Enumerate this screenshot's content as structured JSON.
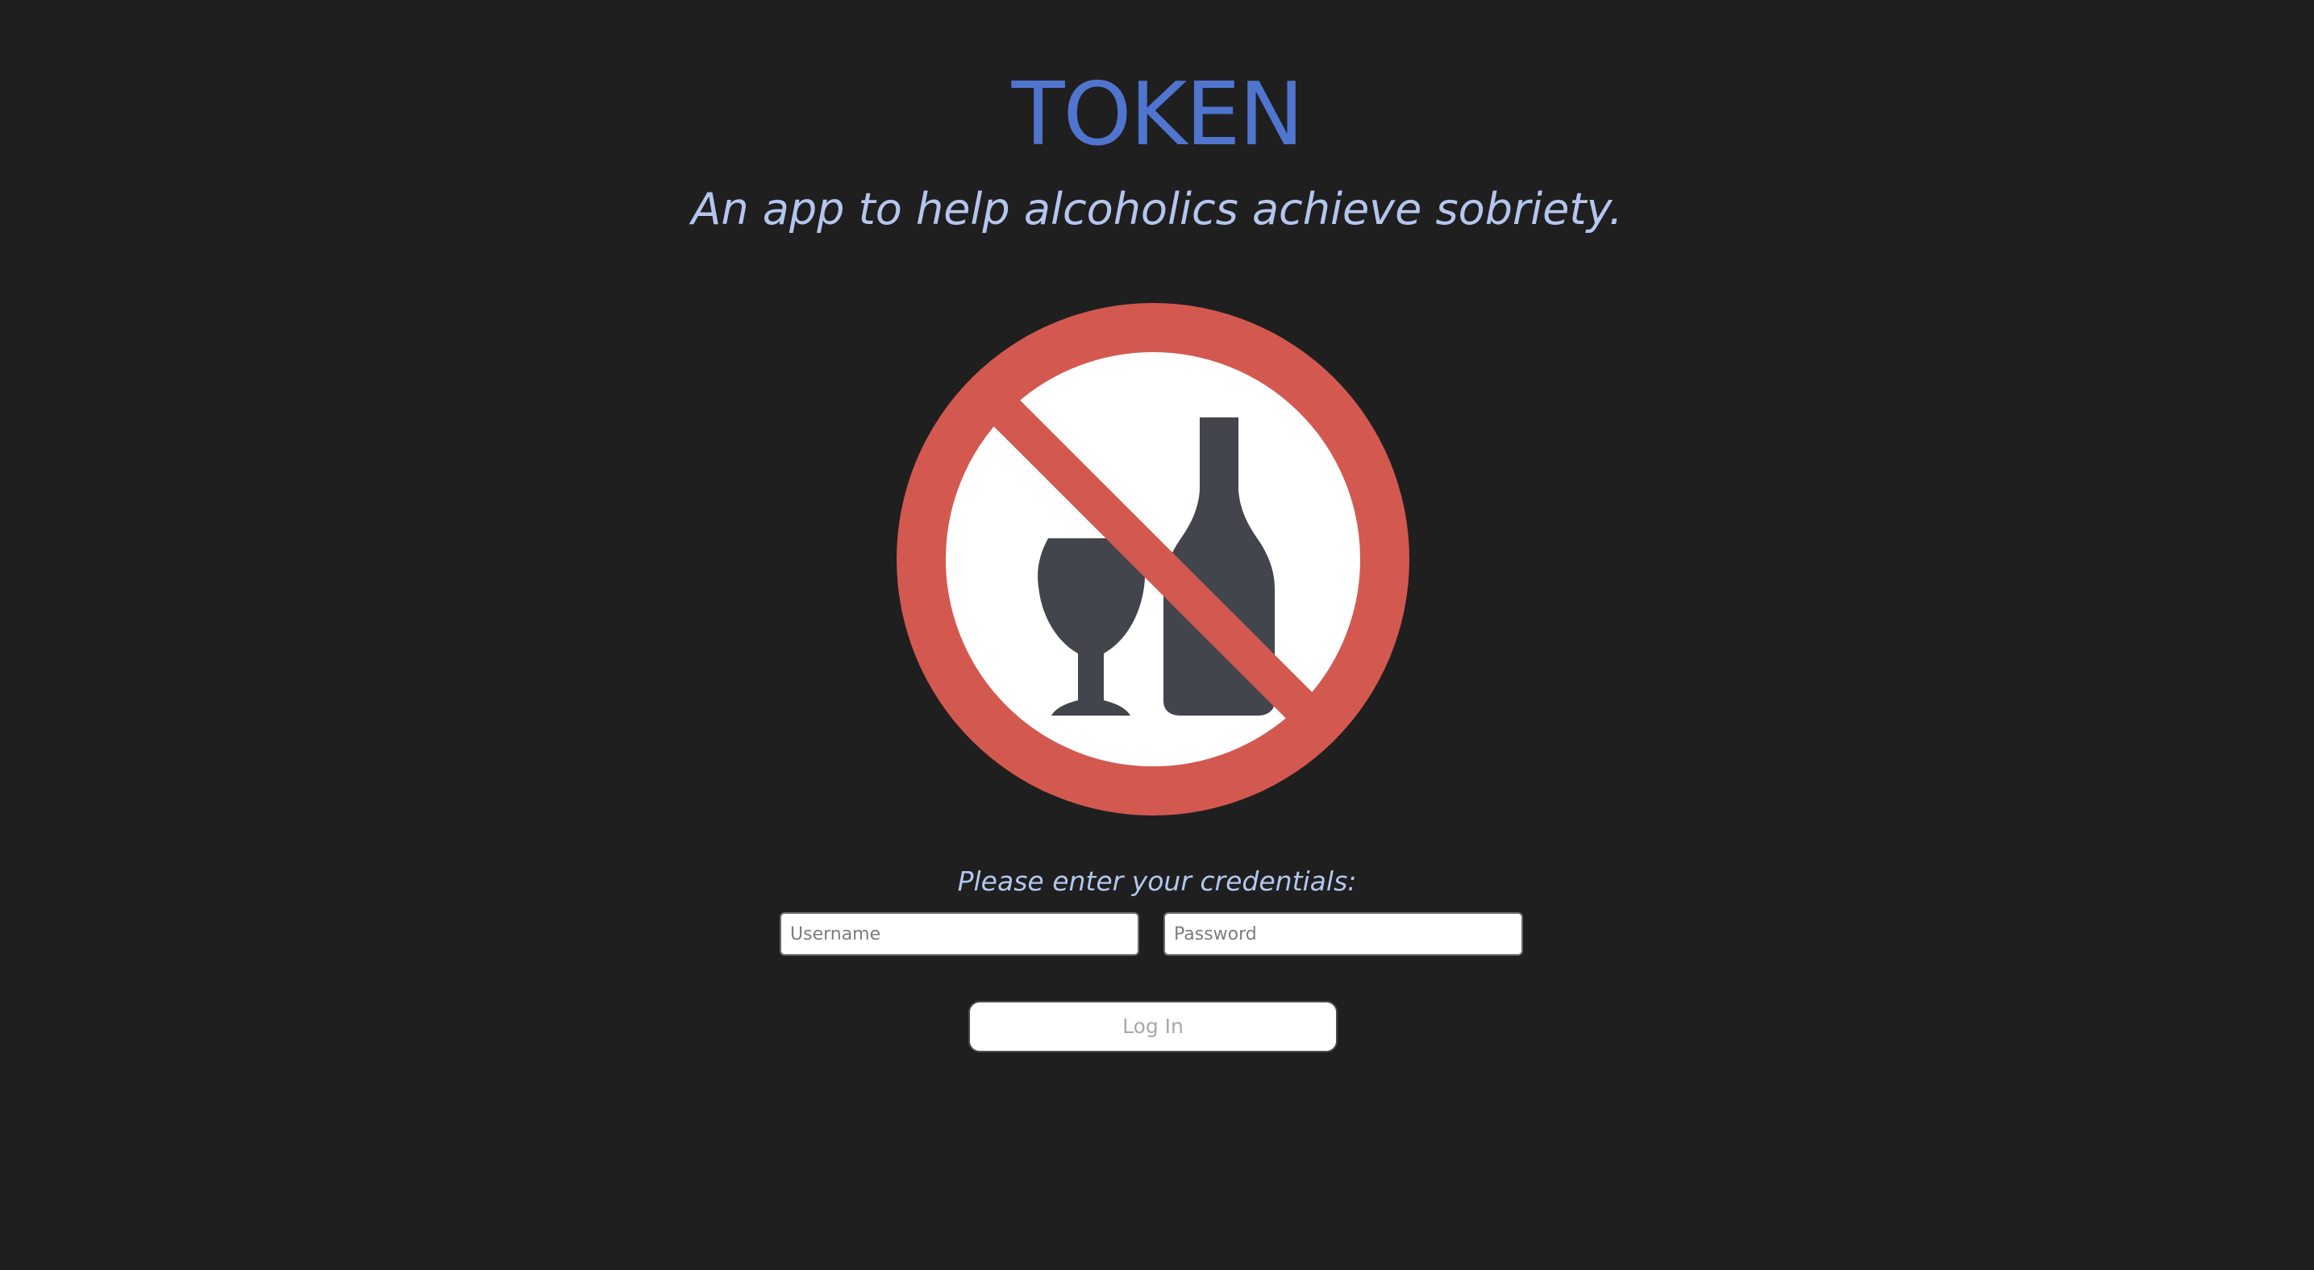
{
  "header": {
    "title": "TOKEN",
    "subtitle": "An app to help alcoholics achieve sobriety."
  },
  "logo": {
    "icon": "no-alcohol-icon",
    "colors": {
      "ring": "#d35950",
      "background": "#ffffff",
      "silhouette": "#42454b"
    }
  },
  "login_form": {
    "prompt": "Please enter your credentials:",
    "username_placeholder": "Username",
    "password_placeholder": "Password",
    "login_label": "Log In"
  },
  "colors": {
    "page_background": "#1f1f1f",
    "title": "#5075cf",
    "subtitle": "#b4c6ee"
  }
}
